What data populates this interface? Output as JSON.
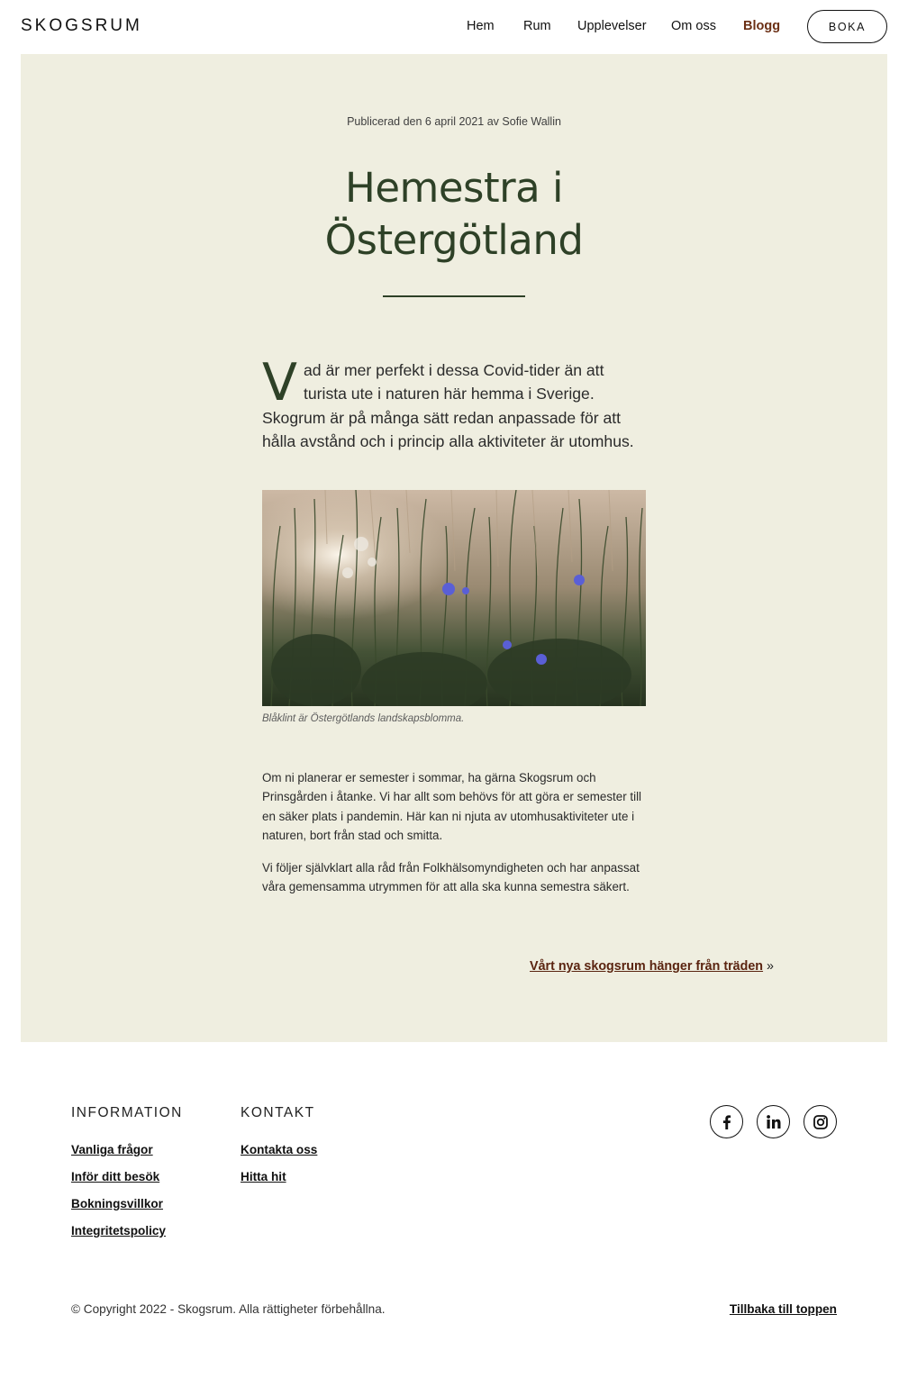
{
  "header": {
    "logo": "SKOGSRUM",
    "nav": [
      {
        "label": "Hem"
      },
      {
        "label": "Rum"
      },
      {
        "label": "Upplevelser"
      },
      {
        "label": "Om oss"
      },
      {
        "label": "Blogg",
        "active": true
      }
    ],
    "cta_label": "BOKA"
  },
  "article": {
    "meta": "Publicerad den 6 april 2021 av Sofie Wallin",
    "title_line1": "Hemestra i",
    "title_line2": "Östergötland",
    "lead_dropcap": "V",
    "lead_text": "ad är mer perfekt i dessa Covid-tider än att turista ute i naturen här hemma i Sverige. Skogrum är på många sätt redan anpassade för att hålla avstånd och i princip alla aktiviteter är utomhus.",
    "image_caption": "Blåklint är Östergötlands landskapsblomma.",
    "paragraphs": [
      "Om ni planerar er semester i sommar, ha gärna Skogsrum och Prinsgården i åtanke. Vi har allt som behövs för att göra er semester till en säker plats i pandemin. Här kan ni njuta av utomhusaktiviteter ute i naturen, bort från stad och smitta.",
      "Vi följer självklart alla råd från Folkhälsomyndigheten och har anpassat våra gemensamma utrymmen för att alla ska kunna semestra säkert."
    ],
    "next_post_label": "Vårt nya skogsrum hänger från träden",
    "next_post_arrow": "»"
  },
  "footer": {
    "information_heading": "INFORMATION",
    "information_links": [
      "Vanliga frågor",
      "Inför ditt besök",
      "Bokningsvillkor",
      "Integritetspolicy"
    ],
    "kontakt_heading": "KONTAKT",
    "kontakt_links": [
      "Kontakta oss",
      "Hitta hit"
    ],
    "social_icons": [
      "facebook-icon",
      "linkedin-icon",
      "instagram-icon"
    ],
    "copyright": "© Copyright 2022 - Skogsrum. Alla rättigheter förbehållna.",
    "back_to_top": "Tillbaka till toppen"
  },
  "colors": {
    "panel_bg": "#efeee0",
    "title_green": "#2e4127",
    "active_nav": "#6b2f14",
    "link_brown": "#5a2410"
  }
}
